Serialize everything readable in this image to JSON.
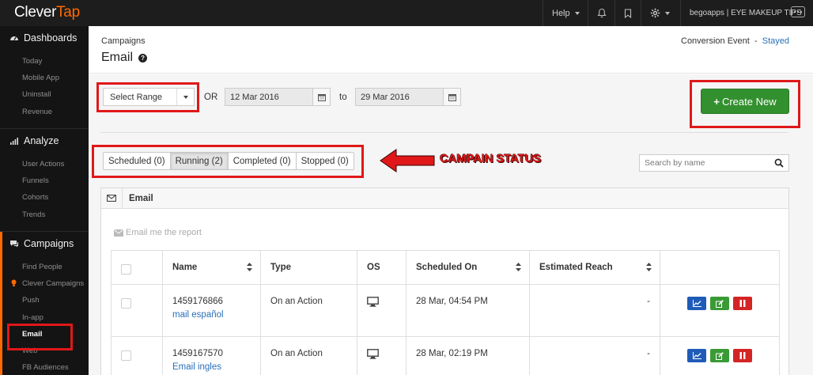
{
  "app": {
    "logo_clever": "Clever",
    "logo_tap": "Tap"
  },
  "topbar": {
    "help": "Help",
    "account": "begoapps | EYE MAKEUP TIPS"
  },
  "sidebar": {
    "dashboards": {
      "label": "Dashboards",
      "items": [
        "Today",
        "Mobile App",
        "Uninstall",
        "Revenue"
      ]
    },
    "analyze": {
      "label": "Analyze",
      "items": [
        "User Actions",
        "Funnels",
        "Cohorts",
        "Trends"
      ]
    },
    "campaigns": {
      "label": "Campaigns",
      "items": [
        "Find People",
        "Clever Campaigns",
        "Push",
        "In-app",
        "Email",
        "Web",
        "FB Audiences"
      ]
    }
  },
  "header": {
    "breadcrumb": "Campaigns",
    "title": "Email",
    "conversion_label": "Conversion Event",
    "conversion_dash": "-",
    "conversion_value": "Stayed"
  },
  "filters": {
    "range_select": "Select Range",
    "or": "OR",
    "from_date": "12 Mar 2016",
    "to": "to",
    "to_date": "29 Mar 2016"
  },
  "create_button": "Create New",
  "tabs": [
    {
      "label": "Scheduled (0)"
    },
    {
      "label": "Running (2)"
    },
    {
      "label": "Completed (0)"
    },
    {
      "label": "Stopped (0)"
    }
  ],
  "annotation": "CAMPAIN STATUS",
  "search": {
    "placeholder": "Search by name"
  },
  "panel": {
    "title": "Email",
    "email_report": "Email me the report"
  },
  "table": {
    "headers": {
      "name": "Name",
      "type": "Type",
      "os": "OS",
      "scheduled": "Scheduled On",
      "reach": "Estimated Reach"
    },
    "rows": [
      {
        "id": "1459176866",
        "name": "mail español",
        "type": "On an Action",
        "scheduled": "28 Mar, 04:54 PM",
        "reach": "-"
      },
      {
        "id": "1459167570",
        "name": "Email ingles",
        "type": "On an Action",
        "scheduled": "28 Mar, 02:19 PM",
        "reach": "-"
      }
    ]
  },
  "colors": {
    "accent_orange": "#ff6a00",
    "create_green": "#33902f",
    "annotation_red": "#e01818",
    "link_blue": "#2a6fb8"
  }
}
